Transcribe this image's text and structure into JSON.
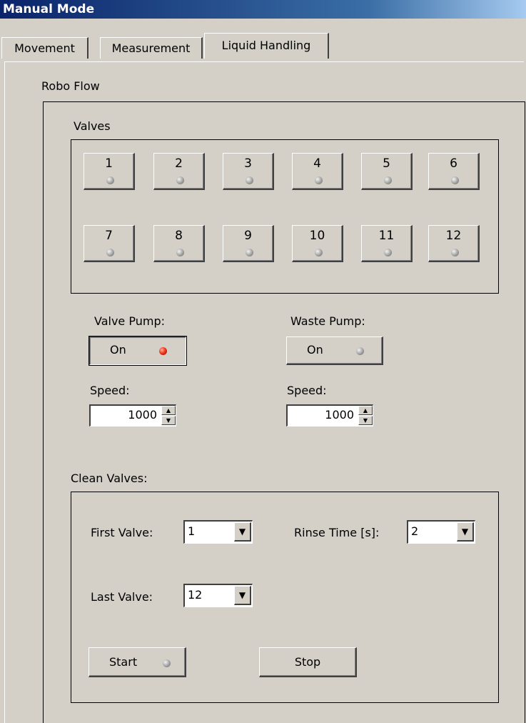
{
  "window": {
    "title": "Manual Mode"
  },
  "tabs": [
    {
      "label": "Movement"
    },
    {
      "label": "Measurement"
    },
    {
      "label": "Liquid Handling"
    }
  ],
  "robo_flow": {
    "title": "Robo Flow",
    "valves": {
      "title": "Valves",
      "buttons": [
        "1",
        "2",
        "3",
        "4",
        "5",
        "6",
        "7",
        "8",
        "9",
        "10",
        "11",
        "12"
      ]
    },
    "valve_pump": {
      "label": "Valve Pump:",
      "button": "On",
      "led": "red",
      "speed_label": "Speed:",
      "speed": "1000"
    },
    "waste_pump": {
      "label": "Waste Pump:",
      "button": "On",
      "led": "gray",
      "speed_label": "Speed:",
      "speed": "1000"
    },
    "clean_valves": {
      "title": "Clean Valves:",
      "first_valve_label": "First Valve:",
      "first_valve": "1",
      "rinse_time_label": "Rinse Time [s]:",
      "rinse_time": "2",
      "last_valve_label": "Last Valve:",
      "last_valve": "12",
      "start_label": "Start",
      "stop_label": "Stop"
    }
  },
  "colors": {
    "led_off": "#a0a0a0",
    "led_on": "#f03a20",
    "titlebar": "#0a246a"
  }
}
